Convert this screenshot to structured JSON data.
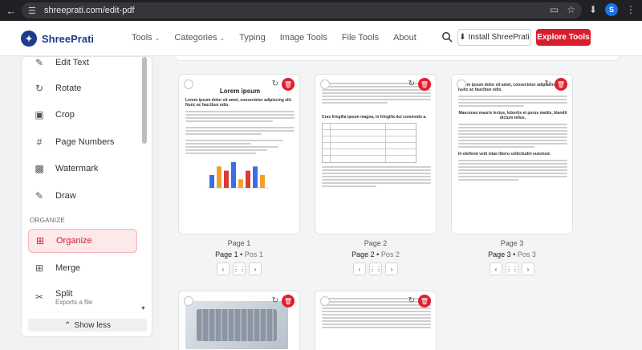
{
  "browser": {
    "url": "shreeprati.com/edit-pdf",
    "avatar_letter": "S"
  },
  "header": {
    "logo_text": "ShreePrati",
    "nav": [
      {
        "label": "Tools",
        "has_dropdown": true
      },
      {
        "label": "Categories",
        "has_dropdown": true
      },
      {
        "label": "Typing",
        "has_dropdown": false
      },
      {
        "label": "Image Tools",
        "has_dropdown": false
      },
      {
        "label": "File Tools",
        "has_dropdown": false
      },
      {
        "label": "About",
        "has_dropdown": false
      }
    ],
    "install_label": "Install ShreePrati",
    "explore_label": "Explore Tools",
    "accent_color": "#d81e2c"
  },
  "sidebar": {
    "items": [
      {
        "label": "Edit Text",
        "icon": "edit-text-icon"
      },
      {
        "label": "Rotate",
        "icon": "rotate-icon"
      },
      {
        "label": "Crop",
        "icon": "crop-icon"
      },
      {
        "label": "Page Numbers",
        "icon": "hash-icon"
      },
      {
        "label": "Watermark",
        "icon": "stamp-icon"
      },
      {
        "label": "Draw",
        "icon": "draw-icon"
      }
    ],
    "section_organize": "ORGANIZE",
    "organize_items": [
      {
        "label": "Organize",
        "icon": "organize-icon",
        "active": true
      },
      {
        "label": "Merge",
        "icon": "merge-icon"
      },
      {
        "label": "Split",
        "icon": "scissors-icon",
        "sub": "Exports a file"
      }
    ],
    "show_less": "Show less"
  },
  "pages": [
    {
      "page_label": "Page 1",
      "pos_page": "Page 1",
      "pos": "Pos 1",
      "title": "Lorem ipsum",
      "subtitle": "Lorem ipsum dolor sit amet, consectetur adipiscing elit. Nunc ac faucibus odio."
    },
    {
      "page_label": "Page 2",
      "pos_page": "Page 2",
      "pos": "Pos 2",
      "heading": "Cras fringilla ipsum magna, in fringilla dui commodo a."
    },
    {
      "page_label": "Page 3",
      "pos_page": "Page 3",
      "pos": "Pos 3",
      "subtitle": "Lorem ipsum dolor sit amet, consectetur adipiscing elit. Nunc ac faucibus odio.",
      "heading": "Maecenas mauris lectus, lobortis et purus mattis, blandit dictum tellus.",
      "heading2": "In eleifend velit vitae libero sollicitudin euismod."
    }
  ],
  "chart_values": [
    3,
    5,
    4,
    6,
    2,
    4,
    5,
    3
  ]
}
